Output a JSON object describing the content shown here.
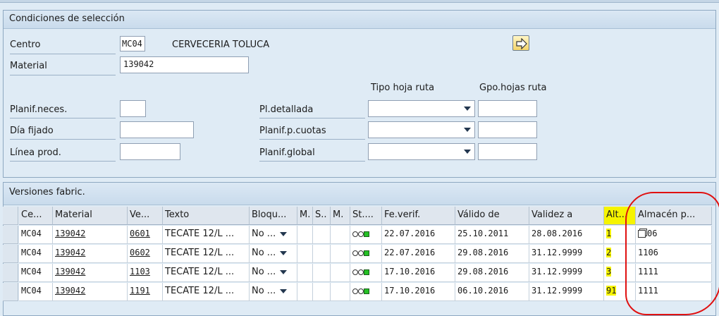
{
  "selection": {
    "title": "Condiciones de selección",
    "centro_label": "Centro",
    "centro_value": "MC04",
    "centro_name": "CERVECERIA TOLUCA",
    "material_label": "Material",
    "material_value": "139042",
    "planif_neces_label": "Planif.neces.",
    "dia_fijado_label": "Día fijado",
    "linea_prod_label": "Línea prod.",
    "tipo_hoja_ruta_label": "Tipo hoja ruta",
    "gpo_hojas_ruta_label": "Gpo.hojas ruta",
    "pl_detallada_label": "Pl.detallada",
    "planif_cuotas_label": "Planif.p.cuotas",
    "planif_global_label": "Planif.global"
  },
  "versions": {
    "title": "Versiones fabric.",
    "columns": [
      "Ce...",
      "Material",
      "Ve...",
      "Texto",
      "Bloqu...",
      "M.",
      "S..",
      "M.",
      "St....",
      "Fe.verif.",
      "Válido de",
      "Validez a",
      "Alt...",
      "Almacén p..."
    ],
    "rows": [
      {
        "centro": "MC04",
        "material": "139042",
        "version": "0601",
        "texto": "TECATE 12/L ...",
        "bloqueo": "No  ...",
        "fe_verif": "22.07.2016",
        "valido_de": "25.10.2011",
        "validez_a": "28.08.2016",
        "alt": "1",
        "almacen": "06"
      },
      {
        "centro": "MC04",
        "material": "139042",
        "version": "0602",
        "texto": "TECATE 12/L ...",
        "bloqueo": "No  ...",
        "fe_verif": "22.07.2016",
        "valido_de": "29.08.2016",
        "validez_a": "31.12.9999",
        "alt": "2",
        "almacen": "1106"
      },
      {
        "centro": "MC04",
        "material": "139042",
        "version": "1103",
        "texto": "TECATE 12/L ...",
        "bloqueo": "No  ...",
        "fe_verif": "17.10.2016",
        "valido_de": "29.08.2016",
        "validez_a": "31.12.9999",
        "alt": "3",
        "almacen": "1111"
      },
      {
        "centro": "MC04",
        "material": "139042",
        "version": "1191",
        "texto": "TECATE 12/L ...",
        "bloqueo": "No  ...",
        "fe_verif": "17.10.2016",
        "valido_de": "06.10.2016",
        "validez_a": "31.12.9999",
        "alt": "91",
        "almacen": "1111"
      }
    ]
  },
  "colors": {
    "highlight": "#f6f400",
    "annotation": "#e01010",
    "status_green": "#25c025"
  },
  "icons": {
    "execute": "execute-arrow-icon",
    "value_help": "value-help-icon",
    "status": "traffic-light-icon"
  }
}
